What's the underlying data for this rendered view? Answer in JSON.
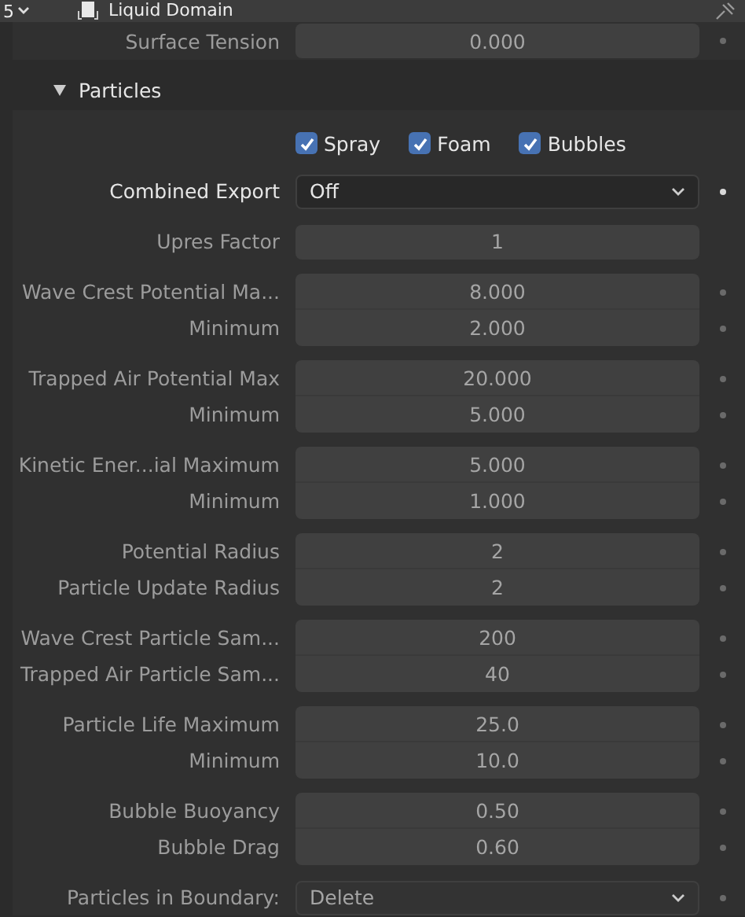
{
  "header": {
    "editor_value": "5",
    "title": "Liquid Domain"
  },
  "surface_tension": {
    "label": "Surface Tension",
    "value": "0.000",
    "disabled": true,
    "animatable": true
  },
  "panel": {
    "title": "Particles",
    "expanded": true
  },
  "checkboxes": [
    {
      "label": "Spray",
      "checked": true
    },
    {
      "label": "Foam",
      "checked": true
    },
    {
      "label": "Bubbles",
      "checked": true
    }
  ],
  "groups": [
    {
      "rows": [
        {
          "label": "Combined Export",
          "value": "Off",
          "kind": "dropdown",
          "disabled": false,
          "animatable": true
        }
      ]
    },
    {
      "rows": [
        {
          "label": "Upres Factor",
          "value": "1",
          "kind": "number",
          "disabled": true,
          "animatable": false
        }
      ]
    },
    {
      "rows": [
        {
          "label": "Wave Crest Potential Ma...",
          "value": "8.000",
          "kind": "number",
          "disabled": true,
          "animatable": true
        },
        {
          "label": "Minimum",
          "value": "2.000",
          "kind": "number",
          "disabled": true,
          "animatable": true
        }
      ]
    },
    {
      "rows": [
        {
          "label": "Trapped Air Potential Max",
          "value": "20.000",
          "kind": "number",
          "disabled": true,
          "animatable": true
        },
        {
          "label": "Minimum",
          "value": "5.000",
          "kind": "number",
          "disabled": true,
          "animatable": true
        }
      ]
    },
    {
      "rows": [
        {
          "label": "Kinetic Ener...ial Maximum",
          "value": "5.000",
          "kind": "number",
          "disabled": true,
          "animatable": true
        },
        {
          "label": "Minimum",
          "value": "1.000",
          "kind": "number",
          "disabled": true,
          "animatable": true
        }
      ]
    },
    {
      "rows": [
        {
          "label": "Potential Radius",
          "value": "2",
          "kind": "number",
          "disabled": true,
          "animatable": true
        },
        {
          "label": "Particle Update Radius",
          "value": "2",
          "kind": "number",
          "disabled": true,
          "animatable": true
        }
      ]
    },
    {
      "rows": [
        {
          "label": "Wave Crest Particle Sam...",
          "value": "200",
          "kind": "number",
          "disabled": true,
          "animatable": true
        },
        {
          "label": "Trapped Air Particle Sam...",
          "value": "40",
          "kind": "number",
          "disabled": true,
          "animatable": true
        }
      ]
    },
    {
      "rows": [
        {
          "label": "Particle Life Maximum",
          "value": "25.0",
          "kind": "number",
          "disabled": true,
          "animatable": true
        },
        {
          "label": "Minimum",
          "value": "10.0",
          "kind": "number",
          "disabled": true,
          "animatable": true
        }
      ]
    },
    {
      "rows": [
        {
          "label": "Bubble Buoyancy",
          "value": "0.50",
          "kind": "number",
          "disabled": true,
          "animatable": true
        },
        {
          "label": "Bubble Drag",
          "value": "0.60",
          "kind": "number",
          "disabled": true,
          "animatable": true
        }
      ]
    },
    {
      "rows": [
        {
          "label": "Particles in Boundary:",
          "value": "Delete",
          "kind": "dropdown",
          "disabled": true,
          "animatable": true
        }
      ]
    }
  ]
}
